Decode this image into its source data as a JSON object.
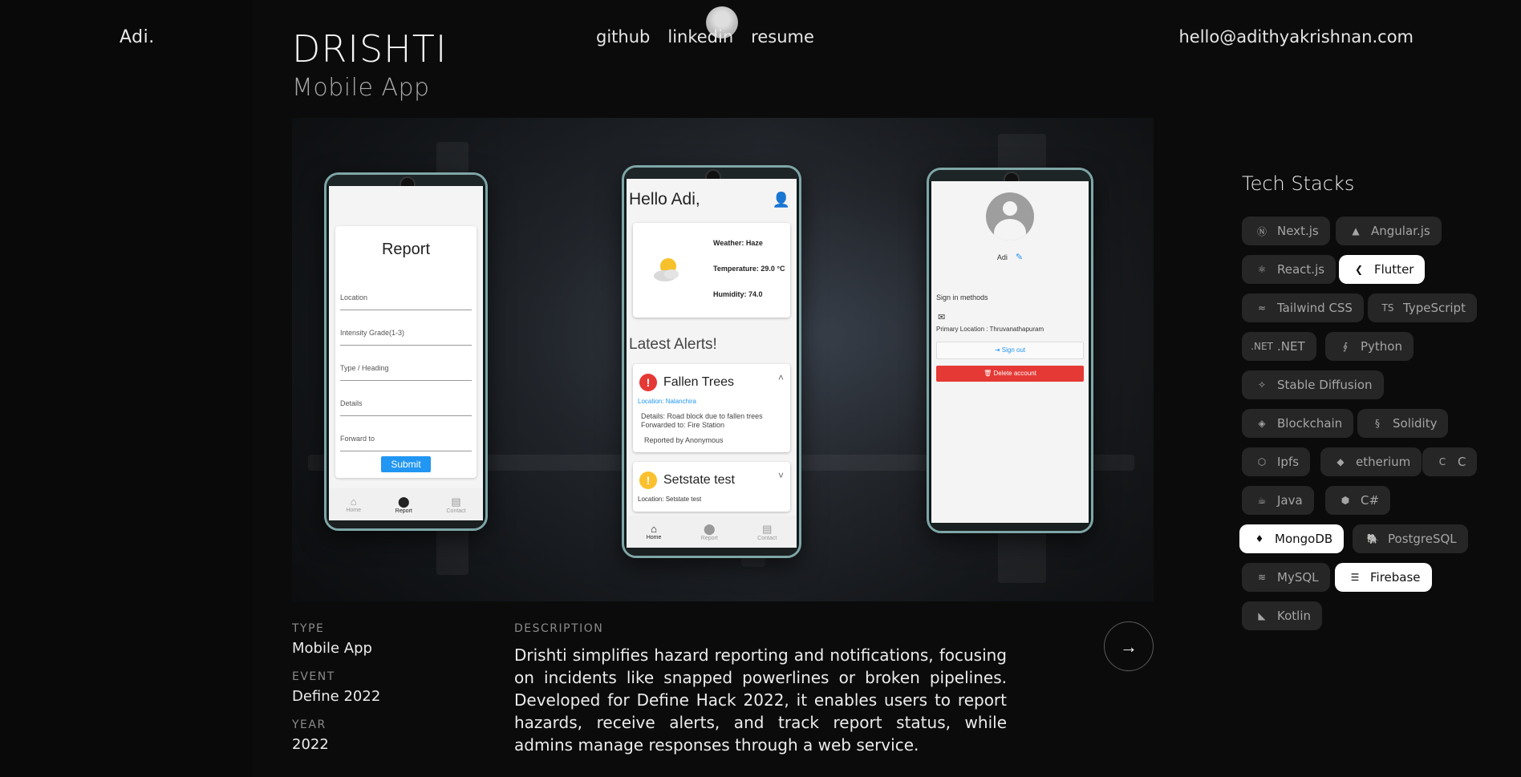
{
  "header": {
    "logo": "Adi.",
    "nav": [
      "github",
      "linkedin",
      "resume"
    ],
    "email": "hello@adithyakrishnan.com"
  },
  "project": {
    "title": "DRISHTI",
    "subtitle": "Mobile App"
  },
  "phones": {
    "report": {
      "title": "Report",
      "fields": [
        "Location",
        "Intensity Grade(1-3)",
        "Type / Heading",
        "Details",
        "Forward to"
      ],
      "submit": "Submit",
      "nav": [
        "Home",
        "Report",
        "Contact"
      ],
      "active": "Report"
    },
    "home": {
      "greeting": "Hello Adi,",
      "weather": "Weather: Haze",
      "temperature": "Temperature: 29.0 °C",
      "humidity": "Humidity: 74.0",
      "alerts_heading": "Latest Alerts!",
      "alert1": {
        "title": "Fallen Trees",
        "location": "Location: Nalanchira",
        "details": "Details: Road block due to fallen trees",
        "forwarded": "Forwarded to: Fire Station",
        "reported_by": "Reported by Anonymous"
      },
      "alert2": {
        "title": "Setstate test",
        "location": "Location: Setstate test"
      },
      "nav": [
        "Home",
        "Report",
        "Contact"
      ],
      "active": "Home"
    },
    "profile": {
      "name": "Adi",
      "sign_in_methods": "Sign in methods",
      "primary_location": "Primary Location : Thruvanathapuram",
      "sign_out": "Sign out",
      "delete": "Delete account"
    }
  },
  "info": {
    "type_label": "TYPE",
    "type_value": "Mobile App",
    "event_label": "EVENT",
    "event_value": "Define 2022",
    "year_label": "YEAR",
    "year_value": "2022",
    "description_label": "DESCRIPTION",
    "description": "Drishti simplifies hazard reporting and notifications, focusing on incidents like snapped powerlines or broken pipelines. Developed for Define Hack 2022, it enables users to report hazards, receive alerts, and track report status, while admins manage responses through a web service."
  },
  "tech_stack": {
    "title": "Tech Stacks",
    "items": [
      {
        "label": "Next.js",
        "icon": "nextjs-icon",
        "active": false
      },
      {
        "label": "Angular.js",
        "icon": "angular-icon",
        "active": false
      },
      {
        "label": "React.js",
        "icon": "react-icon",
        "active": false
      },
      {
        "label": "Flutter",
        "icon": "flutter-icon",
        "active": true
      },
      {
        "label": "Tailwind CSS",
        "icon": "tailwind-icon",
        "active": false
      },
      {
        "label": "TypeScript",
        "icon": "typescript-icon",
        "active": false
      },
      {
        "label": ".NET",
        "icon": "dotnet-icon",
        "active": false
      },
      {
        "label": "Python",
        "icon": "python-icon",
        "active": false
      },
      {
        "label": "Stable Diffusion",
        "icon": "stable-diffusion-icon",
        "active": false
      },
      {
        "label": "Blockchain",
        "icon": "blockchain-icon",
        "active": false
      },
      {
        "label": "Solidity",
        "icon": "solidity-icon",
        "active": false
      },
      {
        "label": "Ipfs",
        "icon": "ipfs-icon",
        "active": false
      },
      {
        "label": "etherium",
        "icon": "ethereum-icon",
        "active": false
      },
      {
        "label": "C",
        "icon": "c-icon",
        "active": false
      },
      {
        "label": "Java",
        "icon": "java-icon",
        "active": false
      },
      {
        "label": "C#",
        "icon": "csharp-icon",
        "active": false
      },
      {
        "label": "MongoDB",
        "icon": "mongodb-icon",
        "active": true
      },
      {
        "label": "PostgreSQL",
        "icon": "postgresql-icon",
        "active": false
      },
      {
        "label": "MySQL",
        "icon": "mysql-icon",
        "active": false
      },
      {
        "label": "Firebase",
        "icon": "firebase-icon",
        "active": true
      },
      {
        "label": "Kotlin",
        "icon": "kotlin-icon",
        "active": false
      }
    ]
  }
}
